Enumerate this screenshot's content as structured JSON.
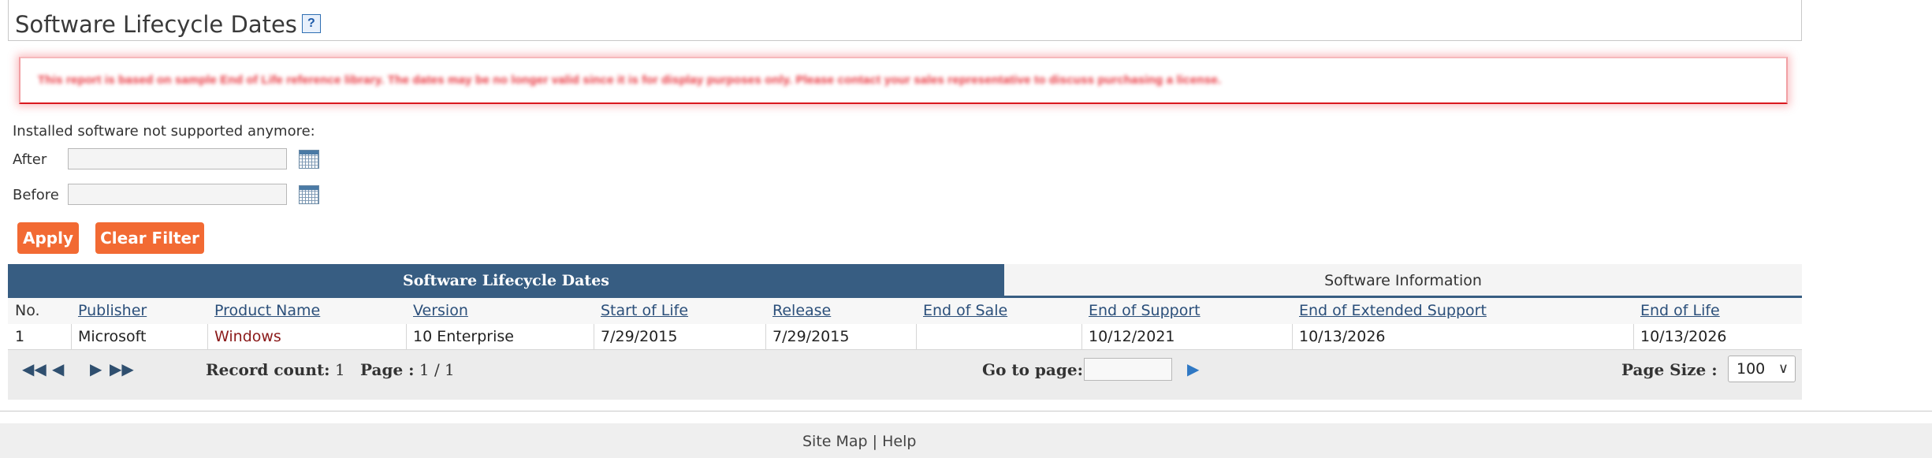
{
  "page": {
    "title": "Software Lifecycle Dates",
    "help_icon": "?"
  },
  "warning": {
    "text": "This report is based on sample End of Life reference library. The dates may be no longer valid since it is for display purposes only. Please contact your sales representative to discuss purchasing a license."
  },
  "filter": {
    "heading": "Installed software not supported anymore:",
    "after_label": "After",
    "after_value": "",
    "before_label": "Before",
    "before_value": "",
    "apply_label": "Apply",
    "clear_label": "Clear Filter"
  },
  "grid": {
    "tabs": [
      {
        "label": "Software Lifecycle Dates",
        "active": true
      },
      {
        "label": "Software Information",
        "active": false
      }
    ],
    "columns": [
      "No.",
      "Publisher",
      "Product Name",
      "Version",
      "Start of Life",
      "Release",
      "End of Sale",
      "End of Support",
      "End of Extended Support",
      "End of Life"
    ],
    "rows": [
      {
        "no": "1",
        "publisher": "Microsoft",
        "product": "Windows",
        "version": "10 Enterprise",
        "start": "7/29/2015",
        "release": "7/29/2015",
        "end_sale": "",
        "end_support": "10/12/2021",
        "end_ext_support": "10/13/2026",
        "end_life": "10/13/2026"
      }
    ],
    "pager": {
      "first_icon": "first-page-icon",
      "prev_icon": "prev-page-icon",
      "next_icon": "next-page-icon",
      "last_icon": "last-page-icon",
      "record_count_label": "Record count:",
      "record_count": "1",
      "page_label": "Page :",
      "page_value": "1 / 1",
      "goto_label": "Go to page:",
      "goto_value": "",
      "page_size_label": "Page Size :",
      "page_size_value": "100"
    }
  },
  "footer": {
    "site_map": "Site Map",
    "separator": "|",
    "help": "Help"
  },
  "colors": {
    "accent_orange": "#f26a33",
    "header_blue": "#375d82",
    "warning_red": "#d9181f",
    "link_blue": "#2b4f7a",
    "product_link_red": "#8b1a1a"
  }
}
